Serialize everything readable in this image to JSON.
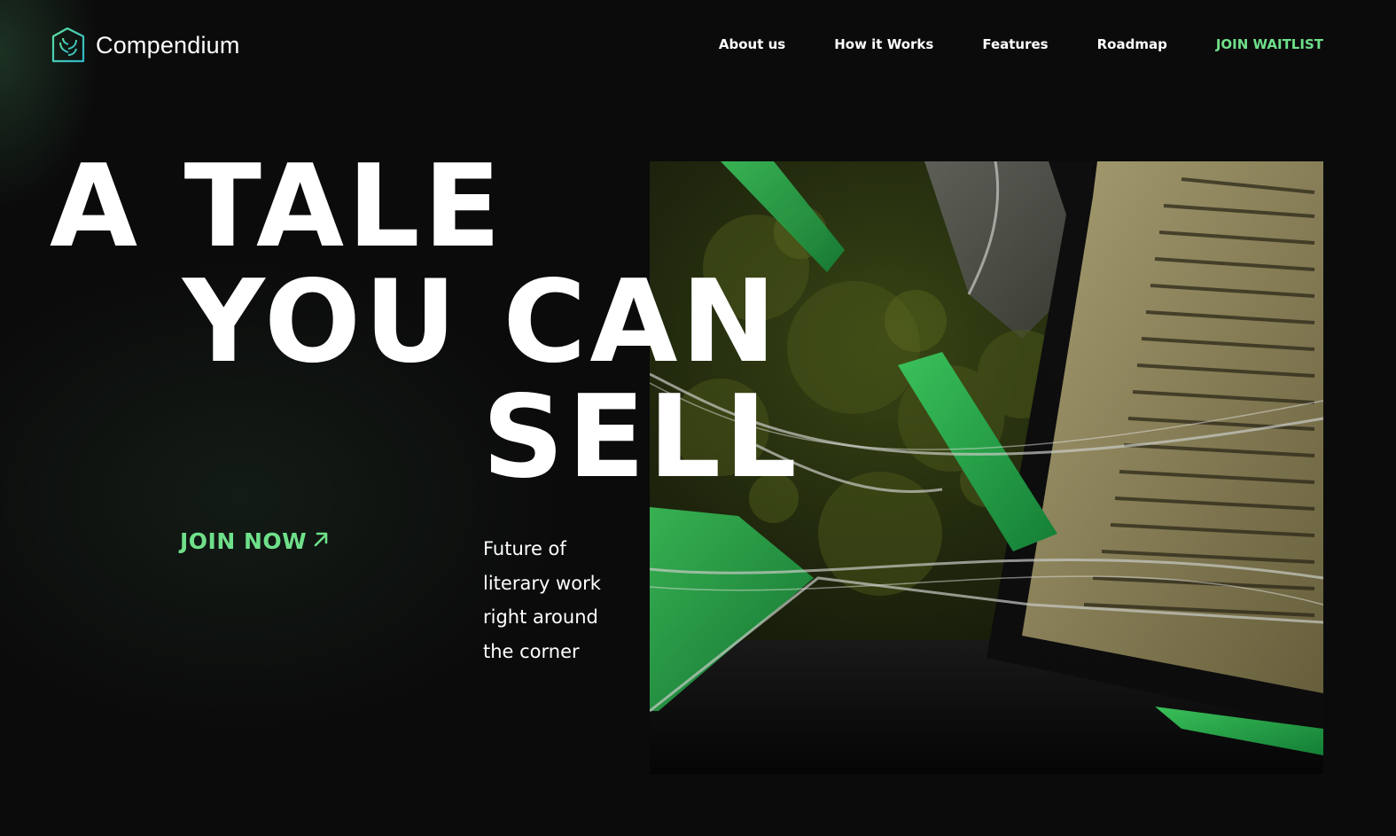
{
  "brand": {
    "name": "Compendium",
    "logo_icon": "tree-house-icon",
    "accent_color": "#6fe08a"
  },
  "nav": {
    "items": [
      {
        "label": "About us"
      },
      {
        "label": "How it Works"
      },
      {
        "label": "Features"
      },
      {
        "label": "Roadmap"
      }
    ],
    "cta_label": "JOIN WAITLIST"
  },
  "hero": {
    "headline": [
      "A TALE",
      "YOU CAN",
      "SELL"
    ],
    "join_label": "JOIN NOW",
    "join_icon": "arrow-up-right-icon",
    "tagline": [
      "Future of",
      "literary work",
      "right around",
      "the corner"
    ],
    "image_subject": "shattered-glass-book-illustration"
  }
}
